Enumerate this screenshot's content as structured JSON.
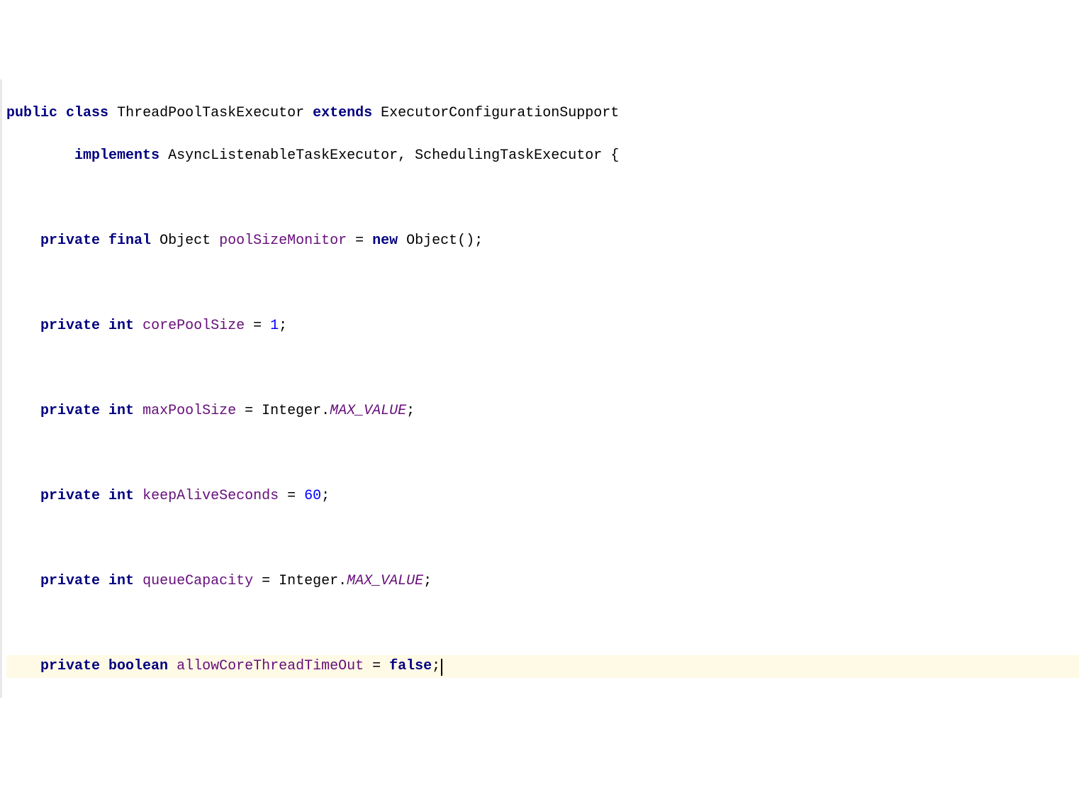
{
  "code": {
    "line1": {
      "kw_public": "public",
      "kw_class": "class",
      "class_name": "ThreadPoolTaskExecutor",
      "kw_extends": "extends",
      "super_class": "ExecutorConfigurationSupport"
    },
    "line2": {
      "kw_implements": "implements",
      "iface1": "AsyncListenableTaskExecutor",
      "comma": ",",
      "iface2": "SchedulingTaskExecutor",
      "brace": " {"
    },
    "line4": {
      "kw_private": "private",
      "kw_final": "final",
      "type": "Object",
      "name": "poolSizeMonitor",
      "eq": " = ",
      "kw_new": "new",
      "ctor": " Object();"
    },
    "line6": {
      "kw_private": "private",
      "kw_int": "int",
      "name": "corePoolSize",
      "eq": " = ",
      "val": "1",
      "semi": ";"
    },
    "line8": {
      "kw_private": "private",
      "kw_int": "int",
      "name": "maxPoolSize",
      "eq": " = Integer.",
      "const": "MAX_VALUE",
      "semi": ";"
    },
    "line10": {
      "kw_private": "private",
      "kw_int": "int",
      "name": "keepAliveSeconds",
      "eq": " = ",
      "val": "60",
      "semi": ";"
    },
    "line12": {
      "kw_private": "private",
      "kw_int": "int",
      "name": "queueCapacity",
      "eq": " = Integer.",
      "const": "MAX_VALUE",
      "semi": ";"
    },
    "line14": {
      "kw_private": "private",
      "kw_boolean": "boolean",
      "name": "allowCoreThreadTimeOut",
      "eq": " = ",
      "kw_false": "false",
      "semi": ";"
    }
  }
}
